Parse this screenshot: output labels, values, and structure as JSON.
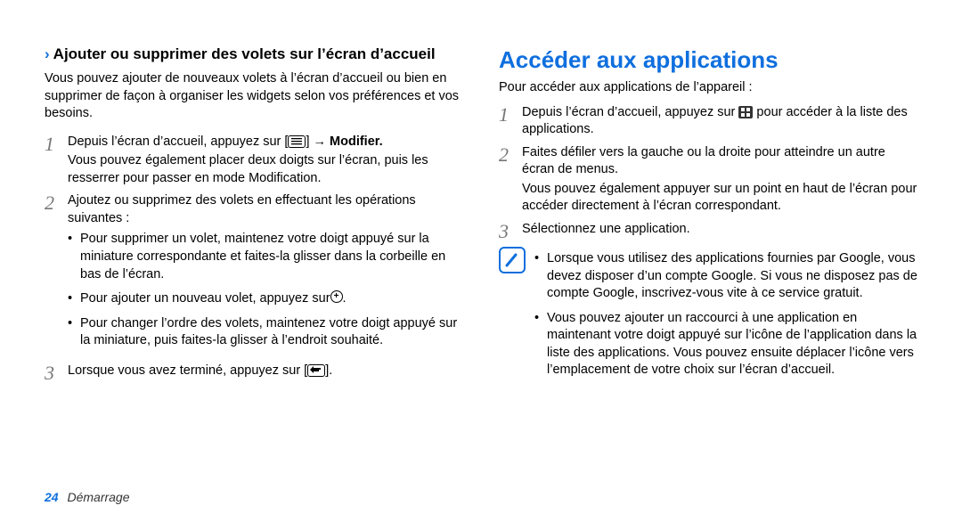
{
  "left": {
    "heading": "Ajouter ou supprimer des volets sur l’écran d’accueil",
    "intro": "Vous pouvez ajouter de nouveaux volets à l’écran d’accueil ou bien en supprimer de façon à organiser les widgets selon vos préférences et vos besoins.",
    "steps": [
      {
        "num": "1",
        "pre": "Depuis l’écran d’accueil, appuyez sur [",
        "post": "] → ",
        "tail_bold": "Modifier.",
        "extra": "Vous pouvez également placer deux doigts sur l’écran, puis les resserrer pour passer en mode Modification."
      },
      {
        "num": "2",
        "text": "Ajoutez ou supprimez des volets en effectuant les opérations suivantes :",
        "bullets": [
          "Pour supprimer un volet, maintenez votre doigt appuyé sur la miniature correspondante et faites-la glisser dans la corbeille en bas de l’écran.",
          "Pour ajouter un nouveau volet, appuyez sur ",
          "Pour changer l’ordre des volets, maintenez votre doigt appuyé sur la miniature, puis faites-la glisser à l’endroit souhaité."
        ]
      },
      {
        "num": "3",
        "pre": "Lorsque vous avez terminé, appuyez sur [",
        "post": "]."
      }
    ]
  },
  "right": {
    "title": "Accéder aux applications",
    "intro": "Pour accéder aux applications de l’appareil :",
    "steps": [
      {
        "num": "1",
        "pre": "Depuis l’écran d’accueil, appuyez sur ",
        "post": " pour accéder à la liste des applications."
      },
      {
        "num": "2",
        "text": "Faites défiler vers la gauche ou la droite pour atteindre un autre écran de menus.",
        "extra": "Vous pouvez également appuyer sur un point en haut de l’écran pour accéder directement à l’écran correspondant."
      },
      {
        "num": "3",
        "text": "Sélectionnez une application."
      }
    ],
    "note_bullets": [
      "Lorsque vous utilisez des applications fournies par Google, vous devez disposer d’un compte Google. Si vous ne disposez pas de compte Google, inscrivez-vous vite à ce service gratuit.",
      "Vous pouvez ajouter un raccourci à une application en maintenant votre doigt appuyé sur l’icône de l’application dans la liste des applications. Vous pouvez ensuite déplacer l’icône vers l’emplacement de votre choix sur l’écran d’accueil."
    ]
  },
  "footer": {
    "page": "24",
    "section": "Démarrage"
  }
}
